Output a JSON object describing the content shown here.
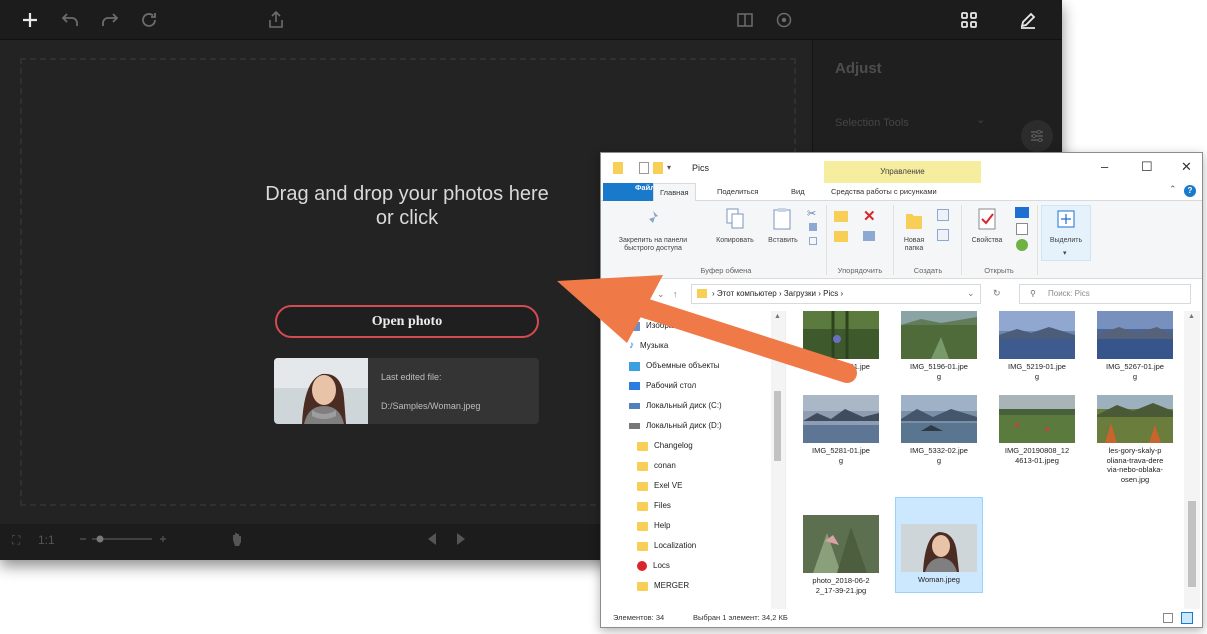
{
  "editor": {
    "drop_text_line1": "Drag and drop your photos here",
    "drop_text_line2": "or click",
    "open_photo_label": "Open photo",
    "last_edited_label": "Last edited file:",
    "last_edited_path": "D:/Samples/Woman.jpeg",
    "zoom_fit_label": "1:1",
    "side_panel": {
      "title": "Adjust",
      "selection_tools": "Selection Tools"
    },
    "accent_color": "#d54b52",
    "icons": [
      "plus-icon",
      "undo-icon",
      "redo-icon",
      "reset-icon",
      "share-icon",
      "compare-icon",
      "preview-icon",
      "grid-icon",
      "pen-icon",
      "fullscreen-icon",
      "hand-icon",
      "prev-icon",
      "next-icon",
      "sliders-icon"
    ]
  },
  "explorer": {
    "title": "Pics",
    "manage_context": "Управление",
    "tabs": {
      "file": "Файл",
      "home": "Главная",
      "share": "Поделиться",
      "view": "Вид",
      "picture_tools": "Средства работы с рисунками"
    },
    "ribbon": {
      "pin_line1": "Закрепить на панели",
      "pin_line2": "быстрого доступа",
      "copy": "Копировать",
      "paste": "Вставить",
      "clipboard_group": "Буфер обмена",
      "organize_group": "Упорядочить",
      "new_folder_line1": "Новая",
      "new_folder_line2": "папка",
      "create_group": "Создать",
      "properties": "Свойства",
      "open_group": "Открыть",
      "select": "Выделить"
    },
    "address": {
      "computer": "Этот компьютер",
      "downloads": "Загрузки",
      "pics": "Pics",
      "search_placeholder": "Поиск: Pics"
    },
    "nav": [
      {
        "label": "Изображения",
        "icon": "pictures-icon"
      },
      {
        "label": "Музыка",
        "icon": "music-icon"
      },
      {
        "label": "Объемные объекты",
        "icon": "3d-objects-icon"
      },
      {
        "label": "Рабочий стол",
        "icon": "desktop-icon"
      },
      {
        "label": "Локальный диск (C:)",
        "icon": "drive-icon"
      },
      {
        "label": "Локальный диск (D:)",
        "icon": "drive-icon"
      },
      {
        "label": "Changelog",
        "icon": "folder-icon"
      },
      {
        "label": "conan",
        "icon": "folder-icon"
      },
      {
        "label": "Exel VE",
        "icon": "folder-icon"
      },
      {
        "label": "Files",
        "icon": "folder-icon"
      },
      {
        "label": "Help",
        "icon": "folder-icon"
      },
      {
        "label": "Localization",
        "icon": "folder-icon"
      },
      {
        "label": "Locs",
        "icon": "folder-icon"
      },
      {
        "label": "MERGER",
        "icon": "folder-icon"
      }
    ],
    "files": [
      {
        "line1": "IMG_5184-01.jpe",
        "line2": "g"
      },
      {
        "line1": "IMG_5196-01.jpe",
        "line2": "g"
      },
      {
        "line1": "IMG_5219-01.jpe",
        "line2": "g"
      },
      {
        "line1": "IMG_5267-01.jpe",
        "line2": "g"
      },
      {
        "line1": "IMG_5281-01.jpe",
        "line2": "g"
      },
      {
        "line1": "IMG_5332-02.jpe",
        "line2": "g"
      },
      {
        "line1": "IMG_20190808_12",
        "line2": "4613-01.jpeg"
      },
      {
        "line1": "les-gory-skaly-p",
        "line2": "oliana-trava-dere",
        "line3": "via-nebo-oblaka-",
        "line4": "osen.jpg"
      },
      {
        "line1": "photo_2018-06-2",
        "line2": "2_17-39-21.jpg"
      },
      {
        "line1": "Woman.jpeg"
      }
    ],
    "status": {
      "items": "Элементов: 34",
      "selected": "Выбран 1 элемент: 34,2 КБ"
    }
  }
}
